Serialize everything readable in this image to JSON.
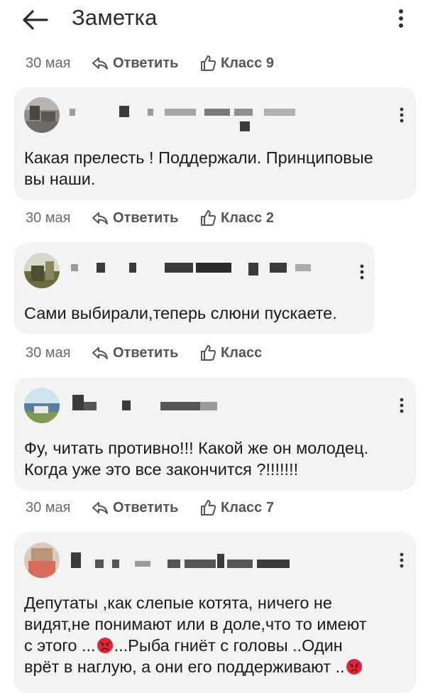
{
  "header": {
    "title": "Заметка",
    "back_icon": "arrow-left-icon",
    "menu_icon": "kebab-menu-icon"
  },
  "note_actions": {
    "date": "30 мая",
    "reply_label": "Ответить",
    "class_label": "Класс 9"
  },
  "comments": [
    {
      "text_lines": [
        "Какая прелесть ! Поддержали. Принциповые",
        "вы наши."
      ],
      "actions": {
        "date": "30 мая",
        "reply_label": "Ответить",
        "class_label": "Класс 2"
      }
    },
    {
      "text_lines": [
        "Сами выбирали,теперь слюни пускаете."
      ],
      "actions": {
        "date": "30 мая",
        "reply_label": "Ответить",
        "class_label": "Класс"
      }
    },
    {
      "text_lines": [
        "Фу, читать противно!!! Какой же он молодец.",
        "Когда уже это все закончится ?!!!!!!!"
      ],
      "actions": {
        "date": "30 мая",
        "reply_label": "Ответить",
        "class_label": "Класс 7"
      }
    },
    {
      "text_lines": [
        "Депутаты ,как слепые котята, ничего не",
        "видят,не понимают или в доле,что то имеют"
      ],
      "line3_a": "с этого ...",
      "line3_b": "...Рыба гниёт с головы ..Один",
      "line4_a": "врёт в наглую, а они его поддерживают ..",
      "emoji": "angry-face-emoji"
    }
  ],
  "colors": {
    "card_bg": "#f3f3f3",
    "action_text": "#555555",
    "emoji_red": "#e0243a"
  }
}
